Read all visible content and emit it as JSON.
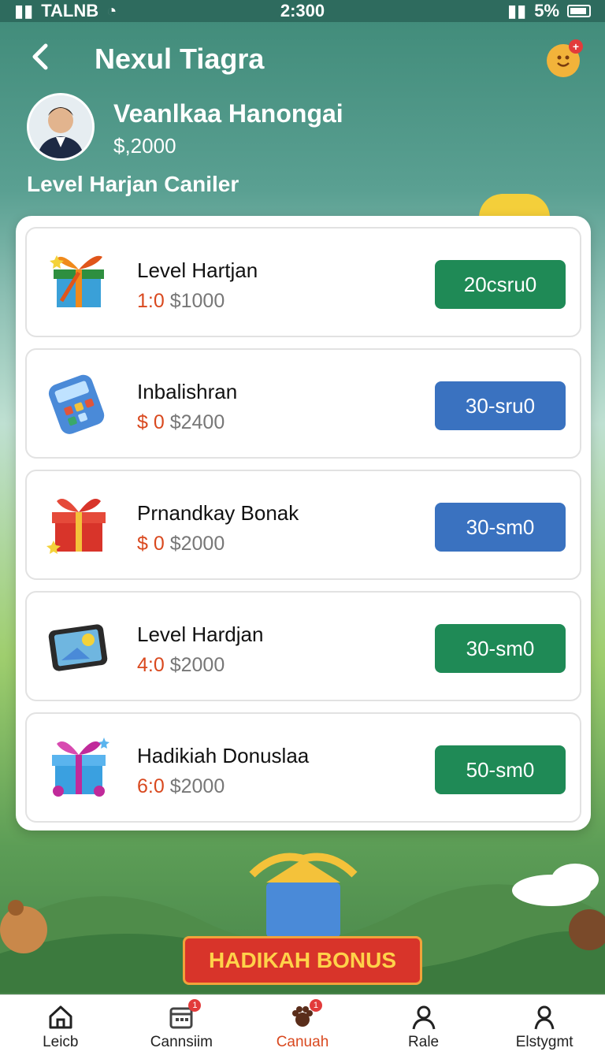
{
  "status_bar": {
    "carrier": "TALNB",
    "time": "2:300",
    "battery": "5%"
  },
  "header": {
    "title": "Nexul Tiagra"
  },
  "profile": {
    "name": "Veanlkaa Hanongai",
    "balance": "$,2000"
  },
  "section_label": "Level Harjan Caniler",
  "rewards": [
    {
      "name": "Level Hartjan",
      "sub_red": "1:0",
      "sub_grey": "$1000",
      "button": "20csru0",
      "button_color": "#1f8a56",
      "icon": "gift-box-icon"
    },
    {
      "name": "Inbalishran",
      "sub_red": "$ 0",
      "sub_grey": "$2400",
      "button": "30-sru0",
      "button_color": "#3a72c0",
      "icon": "calculator-icon"
    },
    {
      "name": "Prnandkay Bonak",
      "sub_red": "$ 0",
      "sub_grey": "$2000",
      "button": "30-sm0",
      "button_color": "#3a72c0",
      "icon": "red-gift-icon"
    },
    {
      "name": "Level Hardjan",
      "sub_red": "4:0",
      "sub_grey": "$2000",
      "button": "30-sm0",
      "button_color": "#1f8a56",
      "icon": "tablet-icon"
    },
    {
      "name": "Hadikiah Donuslaa",
      "sub_red": "6:0",
      "sub_grey": "$2000",
      "button": "50-sm0",
      "button_color": "#1f8a56",
      "icon": "blue-gift-icon"
    }
  ],
  "banner": "HADIKAH BONUS",
  "nav": [
    {
      "label": "Leicb",
      "icon": "home-icon"
    },
    {
      "label": "Cannsiim",
      "icon": "calendar-icon",
      "badge": "1"
    },
    {
      "label": "Canuah",
      "icon": "paw-icon",
      "badge": "1"
    },
    {
      "label": "Rale",
      "icon": "person-icon"
    },
    {
      "label": "Elstygmt",
      "icon": "profile-icon"
    }
  ],
  "colors": {
    "accent_red": "#d9491f",
    "green_button": "#1f8a56",
    "blue_button": "#3a72c0"
  }
}
